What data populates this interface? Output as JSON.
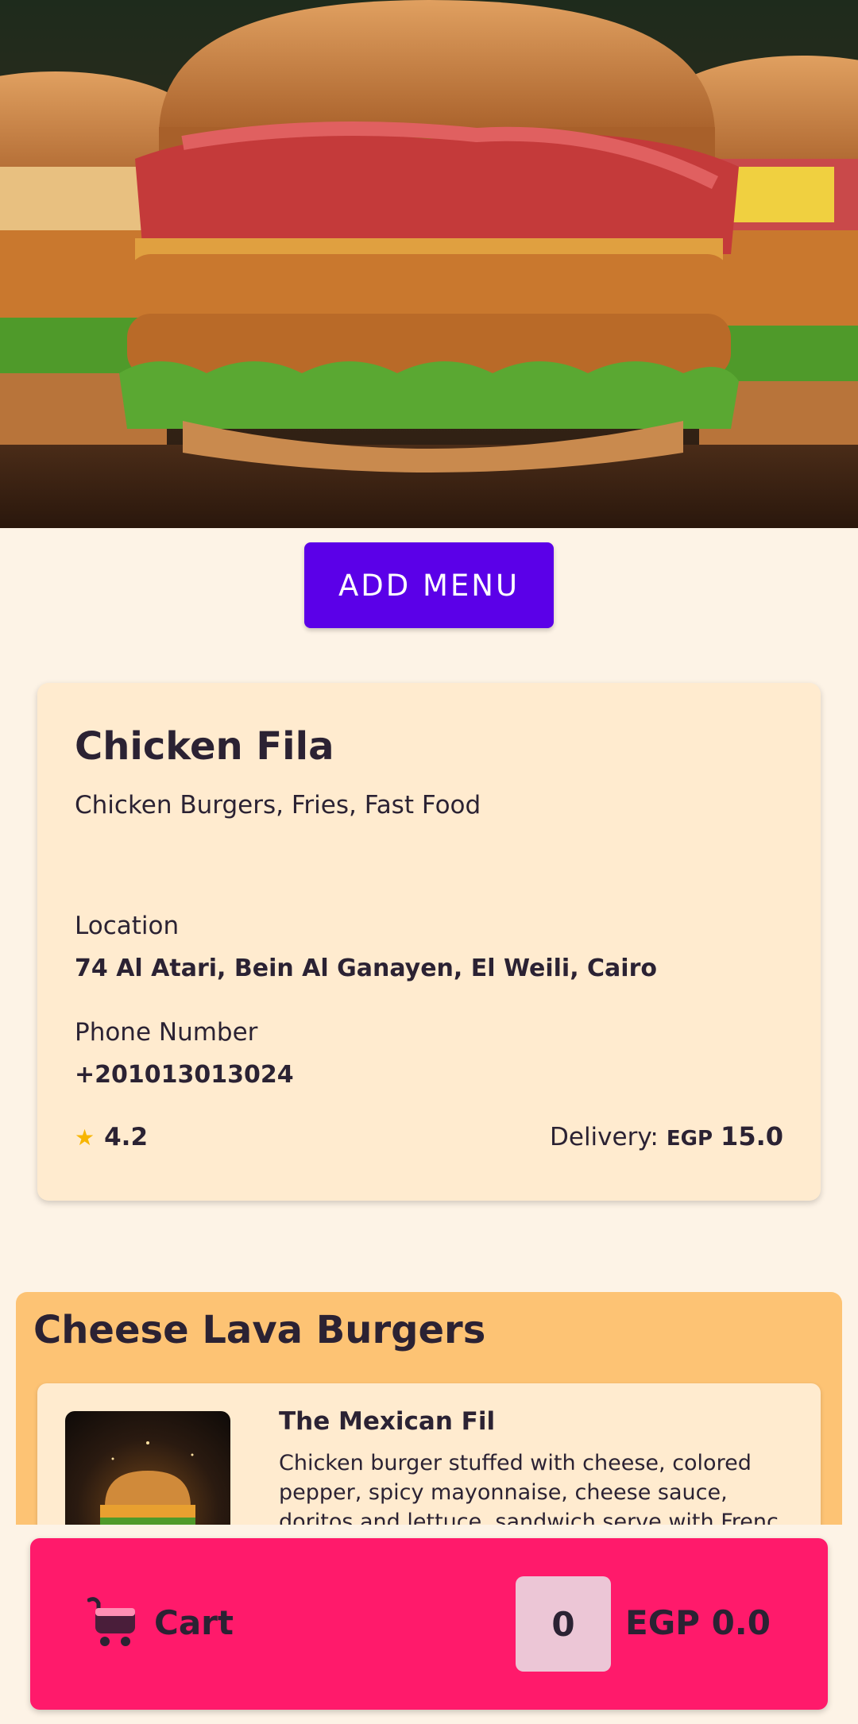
{
  "hero": {
    "image": "burgers-hero-image"
  },
  "actions": {
    "add_menu_label": "ADD MENU"
  },
  "restaurant": {
    "name": "Chicken Fila",
    "categories": "Chicken Burgers, Fries, Fast Food",
    "location_label": "Location",
    "location": "74 Al Atari, Bein Al Ganayen, El Weili, Cairo",
    "phone_label": "Phone Number",
    "phone": "+201013013024",
    "rating": "4.2",
    "delivery_label": "Delivery:",
    "delivery_currency": "EGP",
    "delivery_fee": "15.0"
  },
  "menu": {
    "category_title": "Cheese Lava Burgers",
    "items": [
      {
        "name": "The Mexican Fil",
        "description": "Chicken burger stuffed with cheese, colored pepper, spicy mayonnaise, cheese sauce, doritos and lettuce, sandwich serve with Frenc"
      }
    ]
  },
  "cart": {
    "label": "Cart",
    "count": "0",
    "total": "EGP 0.0"
  },
  "colors": {
    "background": "#fdf3e6",
    "add_menu_button": "#5b00e8",
    "card": "#ffebcf",
    "category_section": "#fdc374",
    "cart_bar": "#ff1a6b",
    "star": "#f7b500"
  },
  "icons": {
    "rating": "star-icon",
    "cart": "cart-icon"
  }
}
